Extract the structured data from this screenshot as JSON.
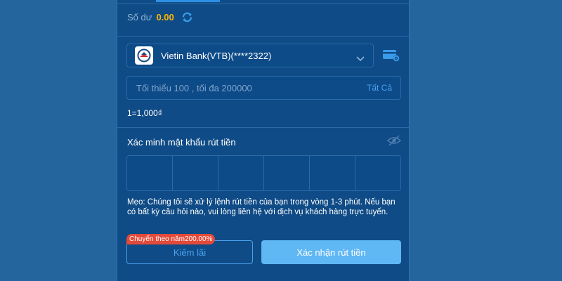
{
  "balance": {
    "label": "Số dư",
    "value": "0.00",
    "refresh_icon": "refresh-icon",
    "value_color": "#ffb400"
  },
  "bank": {
    "name": "Vietin Bank(VTB)(****2322)",
    "logo_icon": "bank-logo-icon",
    "dropdown_icon": "chevron-down-icon",
    "manage_icon": "card-settings-icon"
  },
  "amount": {
    "value": "",
    "placeholder": "Tối thiểu 100 , tối đa 200000",
    "all_label": "Tất Cả"
  },
  "rate": "1=1,000₫",
  "password": {
    "label": "Xác minh mật khẩu rút tiền",
    "toggle_icon": "eye-hidden-icon",
    "digits": [
      "",
      "",
      "",
      "",
      "",
      ""
    ]
  },
  "tip": "Mẹo:  Chúng tôi sẽ xử lý lệnh rút tiền của bạn trong vòng 1-3 phút. Nếu bạn có bất kỳ câu hỏi nào, vui lòng liên hệ với dịch vụ khách hàng trực tuyến.",
  "actions": {
    "promo_badge": "Chuyển theo năm200.00%",
    "earn_label": "Kiếm lãi",
    "confirm_label": "Xác nhận rút tiền"
  },
  "colors": {
    "background": "#24659e",
    "panel": "#0f4b86",
    "accent": "#4aa2ef",
    "confirm": "#5fb7f4",
    "badge": "#e34a3a"
  }
}
